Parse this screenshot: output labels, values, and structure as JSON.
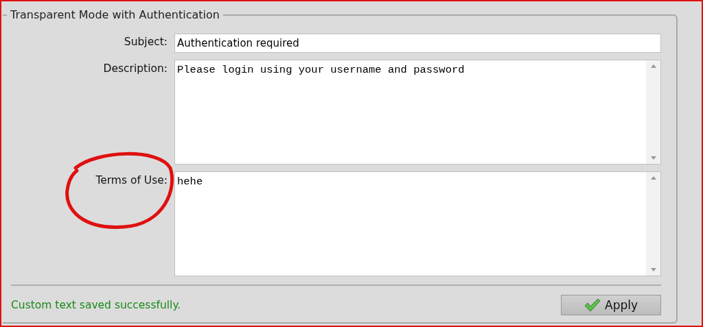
{
  "panel": {
    "title": "Transparent Mode with Authentication"
  },
  "fields": [
    {
      "kind": "input",
      "label": "Subject:",
      "value": "Authentication required"
    },
    {
      "kind": "textarea",
      "label": "Description:",
      "value": "Please login using your username and password"
    },
    {
      "kind": "textarea",
      "label": "Terms of Use:",
      "value": "hehe",
      "annotated": true
    }
  ],
  "status": "Custom text saved successfully.",
  "apply_button": {
    "label": "Apply"
  }
}
